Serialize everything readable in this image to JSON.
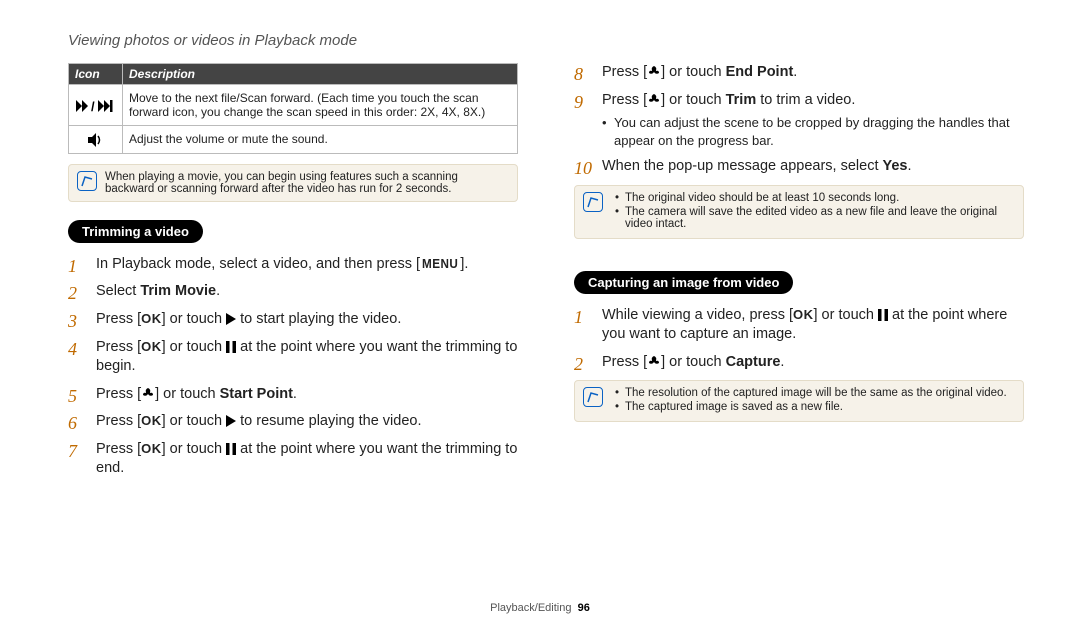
{
  "header": "Viewing photos or videos in Playback mode",
  "table": {
    "th_icon": "Icon",
    "th_desc": "Description",
    "row1_desc": "Move to the next file/Scan forward. (Each time you touch the scan forward icon, you change the scan speed in this order: 2X, 4X, 8X.)",
    "row2_desc": "Adjust the volume or mute the sound."
  },
  "note1": "When playing a movie, you can begin using features such a scanning backward or scanning forward after the video has run for 2 seconds.",
  "section_trim": "Trimming a video",
  "steps_trim": {
    "s1a": "In Playback mode, select a video, and then press [",
    "s1b": "].",
    "s2a": "Select ",
    "s2b": "Trim Movie",
    "s2c": ".",
    "s3a": "Press [",
    "s3b": "] or touch ",
    "s3c": " to start playing the video.",
    "s4a": "Press [",
    "s4b": "] or touch ",
    "s4c": " at the point where you want the trimming to begin.",
    "s5a": "Press [",
    "s5b": "] or touch ",
    "s5c": "Start Point",
    "s5d": ".",
    "s6a": "Press [",
    "s6b": "] or touch ",
    "s6c": " to resume playing the video.",
    "s7a": "Press [",
    "s7b": "] or touch ",
    "s7c": " at the point where you want the trimming to end."
  },
  "steps_right": {
    "s8a": "Press [",
    "s8b": "] or touch ",
    "s8c": "End Point",
    "s8d": ".",
    "s9a": "Press [",
    "s9b": "] or touch ",
    "s9c": "Trim",
    "s9d": " to trim a video.",
    "s9bullet": "You can adjust the scene to be cropped by dragging the handles that appear on the progress bar.",
    "s10a": "When the pop-up message appears, select ",
    "s10b": "Yes",
    "s10c": "."
  },
  "note2a": "The original video should be at least 10 seconds long.",
  "note2b": "The camera will save the edited video as a new file and leave the original video intact.",
  "section_capture": "Capturing an image from video",
  "steps_capture": {
    "s1a": "While viewing a video, press [",
    "s1b": "] or touch ",
    "s1c": " at the point where you want to capture an image.",
    "s2a": "Press [",
    "s2b": "] or touch ",
    "s2c": "Capture",
    "s2d": "."
  },
  "note3a": "The resolution of the captured image will be the same as the original video.",
  "note3b": "The captured image is saved as a new file.",
  "footer_section": "Playback/Editing",
  "footer_page": "96"
}
